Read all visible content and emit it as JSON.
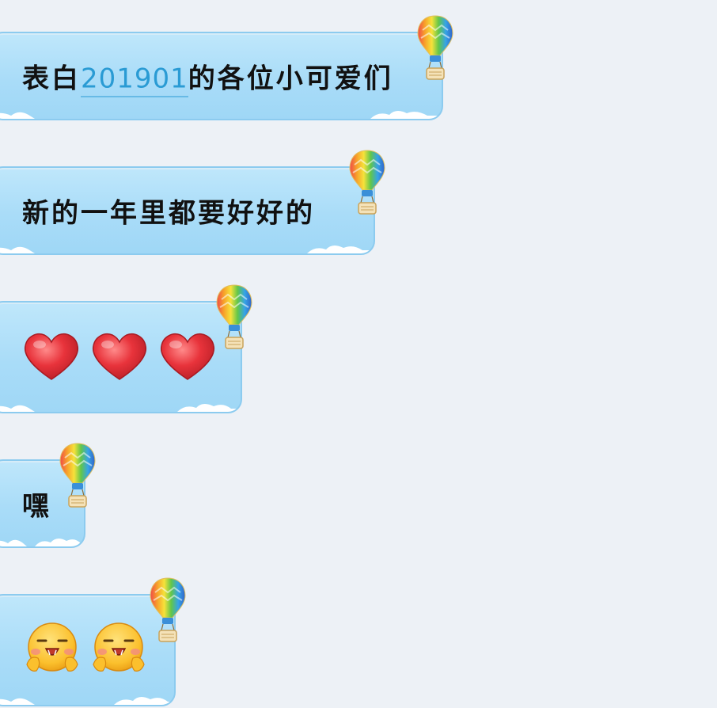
{
  "messages": [
    {
      "type": "text",
      "prefix": "表白",
      "link": "201901",
      "suffix": "的各位小可爱们"
    },
    {
      "type": "text",
      "prefix": "新的一年里都要好好的"
    },
    {
      "type": "emoji",
      "icons": [
        "heart-icon",
        "heart-icon",
        "heart-icon"
      ]
    },
    {
      "type": "text",
      "prefix": "嘿"
    },
    {
      "type": "emoji",
      "icons": [
        "blush-face-icon",
        "blush-face-icon"
      ]
    }
  ],
  "colors": {
    "background": "#edf1f6",
    "bubble": "#a9dcf8",
    "bubble_border": "#8ccbef",
    "link": "#2a9bd4",
    "heart": "#e8333b"
  }
}
